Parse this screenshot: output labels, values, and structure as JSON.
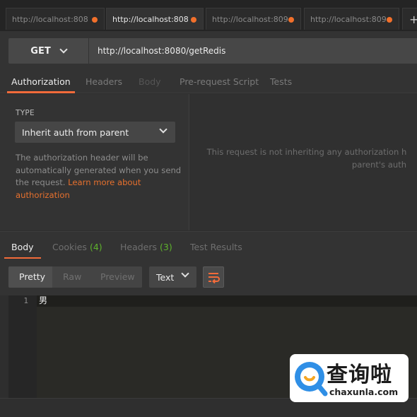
{
  "tabs": [
    {
      "label": "http://localhost:808",
      "active": false
    },
    {
      "label": "http://localhost:808",
      "active": true
    },
    {
      "label": "http://localhost:809",
      "active": false
    },
    {
      "label": "http://localhost:809",
      "active": false
    }
  ],
  "tab_add_label": "+",
  "request": {
    "method": "GET",
    "url": "http://localhost:8080/getRedis"
  },
  "request_tabs": {
    "authorization": "Authorization",
    "headers": "Headers",
    "body": "Body",
    "prerequest": "Pre-request Script",
    "tests": "Tests"
  },
  "auth": {
    "type_label": "TYPE",
    "type_value": "Inherit auth from parent",
    "desc_line1": "The authorization header will be",
    "desc_line2": "automatically generated when you send",
    "desc_line3_prefix": "the request. ",
    "desc_link_1": "Learn more about",
    "desc_link_2": "authorization",
    "message_line1": "This request is not inheriting any authorization h",
    "message_line2": "parent's auth"
  },
  "response_tabs": {
    "body": "Body",
    "cookies": "Cookies",
    "cookies_count": "(4)",
    "headers": "Headers",
    "headers_count": "(3)",
    "test_results": "Test Results"
  },
  "response_toolbar": {
    "pretty": "Pretty",
    "raw": "Raw",
    "preview": "Preview",
    "text_type": "Text"
  },
  "response_body": {
    "line_number": "1",
    "line_text": "男"
  },
  "watermark": {
    "title": "查询啦",
    "url": "chaxunla.com"
  },
  "colors": {
    "accent": "#f26b3a",
    "link": "#e5702e",
    "count_green": "#5eb32c",
    "tab_dot": "#f2702b",
    "watermark_blue": "#2f8fe6"
  }
}
